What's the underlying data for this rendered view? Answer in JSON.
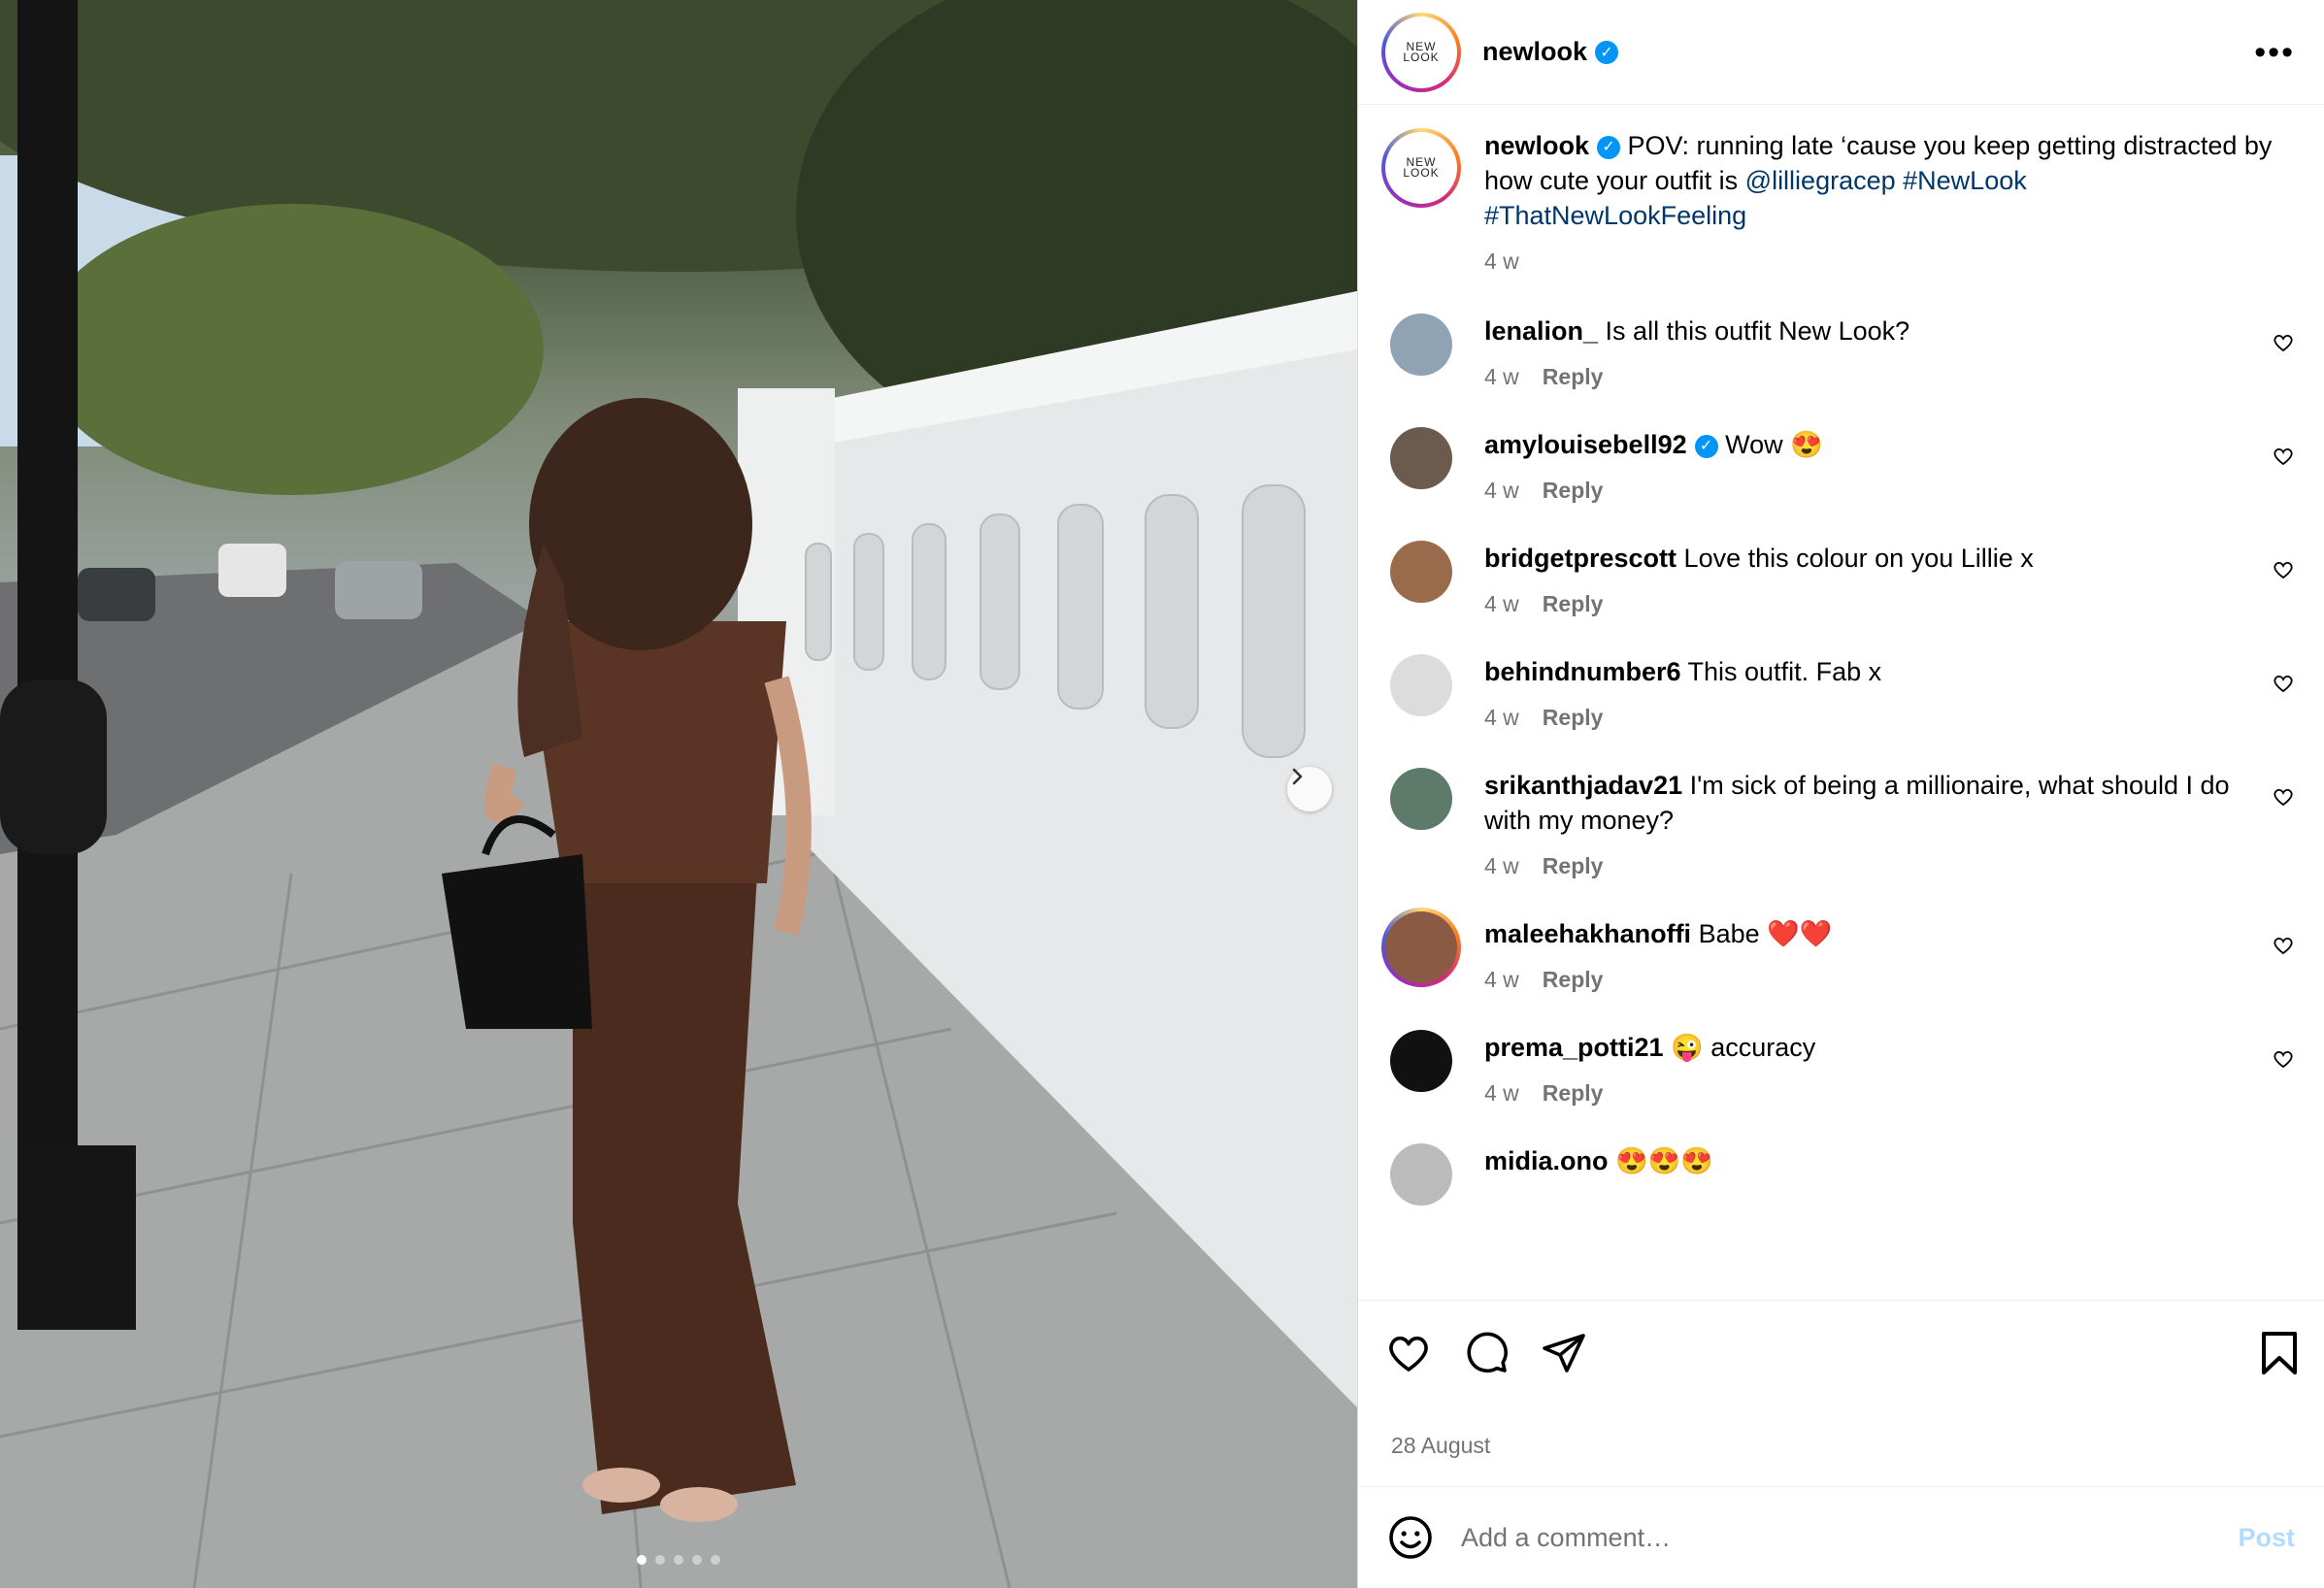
{
  "header": {
    "avatar_text_line1": "NEW",
    "avatar_text_line2": "LOOK",
    "username": "newlook",
    "more_icon": "ellipsis-icon"
  },
  "caption": {
    "username": "newlook",
    "text": "POV: running late ‘cause you keep getting distracted by how cute your outfit is",
    "mention": "@lilliegracep",
    "hashtag1": "#NewLook",
    "hashtag2": "#ThatNewLookFeeling",
    "time": "4 w"
  },
  "comments": [
    {
      "username": "lenalion_",
      "text": "Is all this outfit New Look?",
      "time": "4 w",
      "reply": "Reply",
      "verified": false,
      "avatar_color": "#8fa3b5"
    },
    {
      "username": "amylouisebell92",
      "text": "Wow 😍",
      "time": "4 w",
      "reply": "Reply",
      "verified": true,
      "avatar_color": "#6b5a4e"
    },
    {
      "username": "bridgetprescott",
      "text": "Love this colour on you Lillie x",
      "time": "4 w",
      "reply": "Reply",
      "verified": false,
      "avatar_color": "#9a6b4b"
    },
    {
      "username": "behindnumber6",
      "text": "This outfit. Fab x",
      "time": "4 w",
      "reply": "Reply",
      "verified": false,
      "avatar_color": "#dcdcdc"
    },
    {
      "username": "srikanthjadav21",
      "text": "I'm sick of being a millionaire, what should I do with my money?",
      "time": "4 w",
      "reply": "Reply",
      "verified": false,
      "avatar_color": "#5d7a6a"
    },
    {
      "username": "maleehakhanoffi",
      "text": "Babe ❤️❤️",
      "time": "4 w",
      "reply": "Reply",
      "verified": false,
      "avatar_color": "#8a5a44"
    },
    {
      "username": "prema_potti21",
      "text": "😜 accuracy",
      "time": "4 w",
      "reply": "Reply",
      "verified": false,
      "avatar_color": "#111111"
    },
    {
      "username": "midia.ono",
      "text": "😍😍😍",
      "time": "",
      "reply": "",
      "verified": false,
      "avatar_color": "#bbbbbb"
    }
  ],
  "actions": {
    "like_icon": "heart-icon",
    "comment_icon": "comment-icon",
    "share_icon": "paper-plane-icon",
    "save_icon": "bookmark-icon"
  },
  "post_date": "28 August",
  "comment_box": {
    "emoji_icon": "smiley-icon",
    "placeholder": "Add a comment…",
    "post_label": "Post"
  },
  "carousel": {
    "slide_count": 5,
    "active_slide": 1,
    "next_icon": "chevron-right-icon"
  },
  "colors": {
    "link": "#00376b",
    "muted": "#737373",
    "verified": "#0095f6",
    "post_disabled": "#b3dbff"
  }
}
